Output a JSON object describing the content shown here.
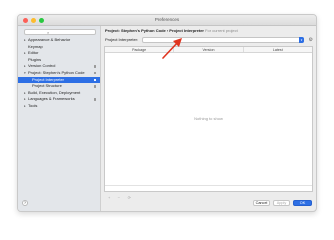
{
  "window": {
    "title": "Preferences"
  },
  "sidebar": {
    "search_placeholder": "",
    "items": [
      {
        "label": "Appearance & Behavior",
        "expander": "▸"
      },
      {
        "label": "Keymap",
        "expander": ""
      },
      {
        "label": "Editor",
        "expander": "▸"
      },
      {
        "label": "Plugins",
        "expander": ""
      },
      {
        "label": "Version Control",
        "expander": "▸"
      },
      {
        "label": "Project: Stephen's Python Code",
        "expander": "▾"
      },
      {
        "label": "Project Interpreter",
        "expander": ""
      },
      {
        "label": "Project Structure",
        "expander": ""
      },
      {
        "label": "Build, Execution, Deployment",
        "expander": "▸"
      },
      {
        "label": "Languages & Frameworks",
        "expander": "▸"
      },
      {
        "label": "Tools",
        "expander": "▸"
      }
    ],
    "help": "?"
  },
  "main": {
    "breadcrumb": {
      "path": "Project: Stephen's Python Code › Project Interpreter",
      "note": "For current project"
    },
    "interpreter_label": "Project Interpreter:",
    "interpreter_value": "",
    "table": {
      "columns": [
        "Package",
        "Version",
        "Latest"
      ],
      "empty_text": "Nothing to show",
      "footer_controls": [
        "+",
        "−",
        "⟳"
      ]
    }
  },
  "buttons": {
    "cancel": "Cancel",
    "apply": "Apply",
    "ok": "OK"
  },
  "colors": {
    "accent": "#2d6fe5",
    "annotation_arrow": "#e0341f"
  },
  "icons": {
    "search": "search-icon",
    "gear": "gear-icon",
    "dropdown": "chevron-down-icon"
  }
}
